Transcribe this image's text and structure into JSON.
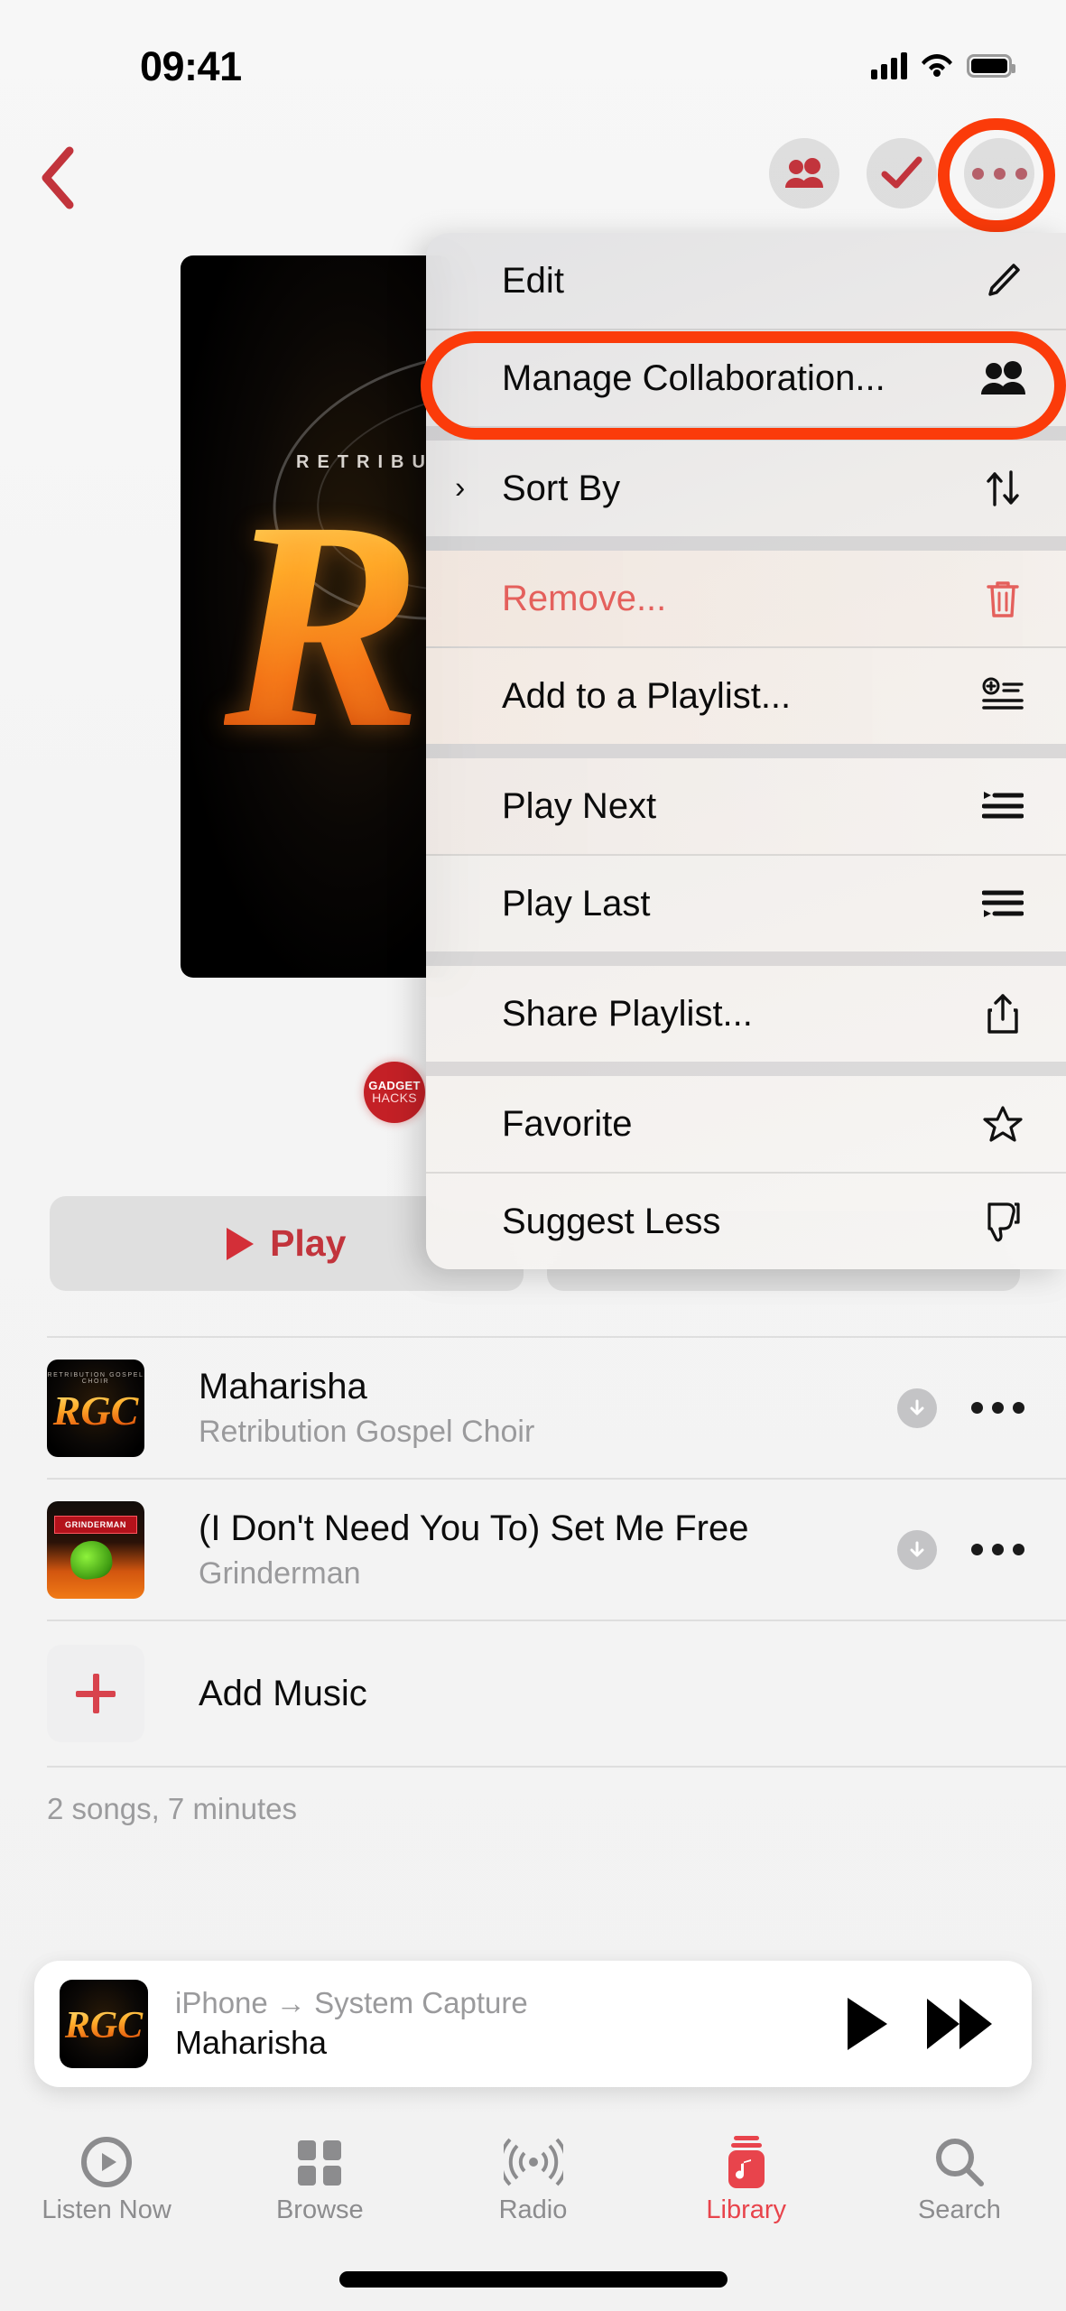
{
  "status_bar": {
    "time": "09:41",
    "signal_icon": "cellular-bars-icon",
    "wifi_icon": "wifi-icon",
    "battery_icon": "battery-full-icon"
  },
  "nav_bar": {
    "back_icon": "chevron-left-icon",
    "actions": [
      {
        "name": "collaboration-button",
        "icon": "people-two-icon"
      },
      {
        "name": "done-button",
        "icon": "checkmark-icon"
      },
      {
        "name": "more-button",
        "icon": "ellipsis-icon",
        "highlighted": true
      }
    ],
    "accent_color": "#c2343c"
  },
  "annotations": {
    "ring_color": "#fb3b0a",
    "targets": [
      "more-button",
      "menu-item-manage-collaboration"
    ]
  },
  "album": {
    "logo_text": "R",
    "overline_text": "RETRIBU",
    "watermark": {
      "line1": "GADGET",
      "line2": "HACKS",
      "color": "#c42026"
    }
  },
  "actions_row": {
    "play_label": "Play",
    "play_icon": "play-triangle-icon",
    "shuffle_label": ""
  },
  "context_menu": {
    "items": [
      {
        "label": "Edit",
        "icon": "pencil-icon",
        "danger": false,
        "prefix": ""
      },
      {
        "label": "Manage Collaboration...",
        "icon": "people-two-icon",
        "danger": false,
        "prefix": ""
      },
      {
        "label": "Sort By",
        "icon": "arrow-up-down-icon",
        "danger": false,
        "prefix": "›"
      },
      {
        "label": "Remove...",
        "icon": "trash-icon",
        "danger": true,
        "prefix": ""
      },
      {
        "label": "Add to a Playlist...",
        "icon": "list-add-icon",
        "danger": false,
        "prefix": ""
      },
      {
        "label": "Play Next",
        "icon": "play-next-icon",
        "danger": false,
        "prefix": ""
      },
      {
        "label": "Play Last",
        "icon": "play-last-icon",
        "danger": false,
        "prefix": ""
      },
      {
        "label": "Share Playlist...",
        "icon": "share-icon",
        "danger": false,
        "prefix": ""
      },
      {
        "label": "Favorite",
        "icon": "star-outline-icon",
        "danger": false,
        "prefix": ""
      },
      {
        "label": "Suggest Less",
        "icon": "thumbs-down-icon",
        "danger": false,
        "prefix": ""
      }
    ],
    "danger_color": "#e4605c"
  },
  "song_list": {
    "songs": [
      {
        "title": "Maharisha",
        "artist": "Retribution Gospel Choir",
        "art": "rgc",
        "art_text": "RGC",
        "art_overline": "RETRIBUTION GOSPEL CHOIR",
        "download_icon": "download-circle-icon",
        "more_icon": "ellipsis-icon"
      },
      {
        "title": "(I Don't Need You To) Set Me Free",
        "artist": "Grinderman",
        "art": "grinder",
        "art_text": "GRINDERMAN",
        "art_overline": "",
        "download_icon": "download-circle-icon",
        "more_icon": "ellipsis-icon"
      }
    ],
    "add_music_label": "Add Music",
    "add_music_icon": "plus-icon",
    "footer": "2 songs, 7 minutes"
  },
  "mini_player": {
    "route": "iPhone → System Capture",
    "title": "Maharisha",
    "art_text": "RGC",
    "play_icon": "play-triangle-icon",
    "forward_icon": "fast-forward-icon"
  },
  "tab_bar": {
    "tabs": [
      {
        "label": "Listen Now",
        "icon": "play-circle-icon",
        "active": false
      },
      {
        "label": "Browse",
        "icon": "grid-icon",
        "active": false
      },
      {
        "label": "Radio",
        "icon": "broadcast-icon",
        "active": false
      },
      {
        "label": "Library",
        "icon": "music-library-icon",
        "active": true
      },
      {
        "label": "Search",
        "icon": "search-icon",
        "active": false
      }
    ],
    "active_color": "#e8444c"
  }
}
